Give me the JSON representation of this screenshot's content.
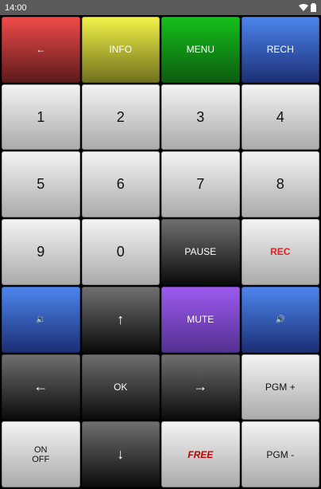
{
  "status_bar": {
    "time": "14:00"
  },
  "buttons": [
    {
      "label": "←"
    },
    {
      "label": "INFO"
    },
    {
      "label": "MENU"
    },
    {
      "label": "RECH"
    },
    {
      "label": "1"
    },
    {
      "label": "2"
    },
    {
      "label": "3"
    },
    {
      "label": "4"
    },
    {
      "label": "5"
    },
    {
      "label": "6"
    },
    {
      "label": "7"
    },
    {
      "label": "8"
    },
    {
      "label": "9"
    },
    {
      "label": "0"
    },
    {
      "label": "PAUSE"
    },
    {
      "label": "REC"
    },
    {
      "label": "🔉"
    },
    {
      "label": "↑"
    },
    {
      "label": "MUTE"
    },
    {
      "label": "🔊"
    },
    {
      "label": "←"
    },
    {
      "label": "OK"
    },
    {
      "label": "→"
    },
    {
      "label": "PGM +"
    },
    {
      "label": "ON\nOFF"
    },
    {
      "label": "↓"
    },
    {
      "label": "FREE"
    },
    {
      "label": "PGM -"
    }
  ],
  "colors": {
    "red": "#f24b4b",
    "yellow": "#f3f349",
    "green": "#15c11a",
    "blue": "#4d86ef",
    "purple": "#9e5af0"
  }
}
